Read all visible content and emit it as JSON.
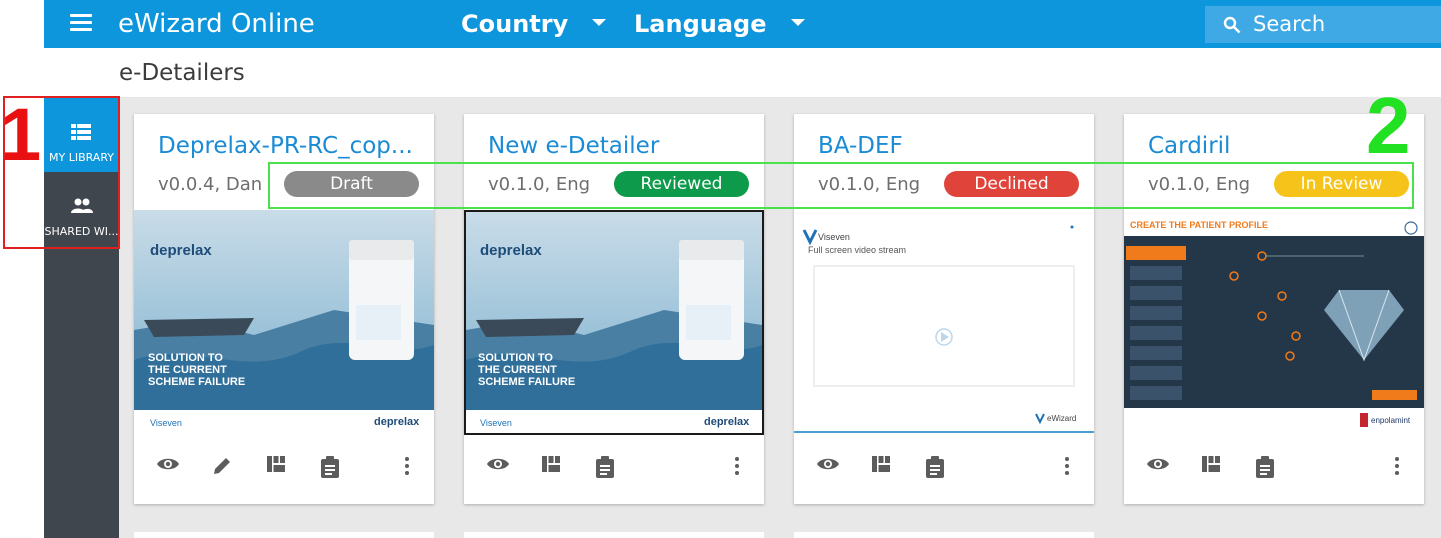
{
  "app": {
    "title": "eWizard Online"
  },
  "header": {
    "country_label": "Country",
    "language_label": "Language",
    "search_placeholder": "Search"
  },
  "breadcrumb": "e-Detailers",
  "sidebar": {
    "items": [
      {
        "label": "MY LIBRARY",
        "icon": "library-icon",
        "active": true
      },
      {
        "label": "SHARED WI...",
        "icon": "people-icon",
        "active": false
      }
    ]
  },
  "cards": [
    {
      "title": "Deprelax-PR-RC_cop...",
      "meta": "v0.0.4,  Dan",
      "status": "Draft",
      "status_color": "#8a8a8a",
      "thumb": {
        "brand": "deprelax",
        "headline": [
          "SOLUTION TO",
          "THE CURRENT",
          "SCHEME FAILURE"
        ],
        "footer_left": "Viseven",
        "footer_right": "deprelax"
      }
    },
    {
      "title": "New e-Detailer",
      "meta": "v0.1.0,  Eng",
      "status": "Reviewed",
      "status_color": "#0d9a4a",
      "thumb": {
        "brand": "deprelax",
        "headline": [
          "SOLUTION TO",
          "THE CURRENT",
          "SCHEME FAILURE"
        ],
        "footer_left": "Viseven",
        "footer_right": "deprelax"
      }
    },
    {
      "title": "BA-DEF",
      "meta": "v0.1.0,  Eng",
      "status": "Declined",
      "status_color": "#e0433a",
      "thumb": {
        "brand": "Viseven",
        "caption": "Full screen video stream",
        "footer_right": "eWizard"
      }
    },
    {
      "title": "Cardiril",
      "meta": "v0.1.0,  Eng",
      "status": "In Review",
      "status_color": "#f6c31a",
      "thumb": {
        "heading": "CREATE THE PATIENT PROFILE",
        "footer_right": "enpolamint"
      }
    }
  ],
  "annotations": {
    "first": "1",
    "second": "2"
  },
  "colors": {
    "primary": "#0d96dc",
    "sidebar": "#3f464d",
    "annotation_red": "#e02020",
    "annotation_green": "#4ce04c"
  }
}
